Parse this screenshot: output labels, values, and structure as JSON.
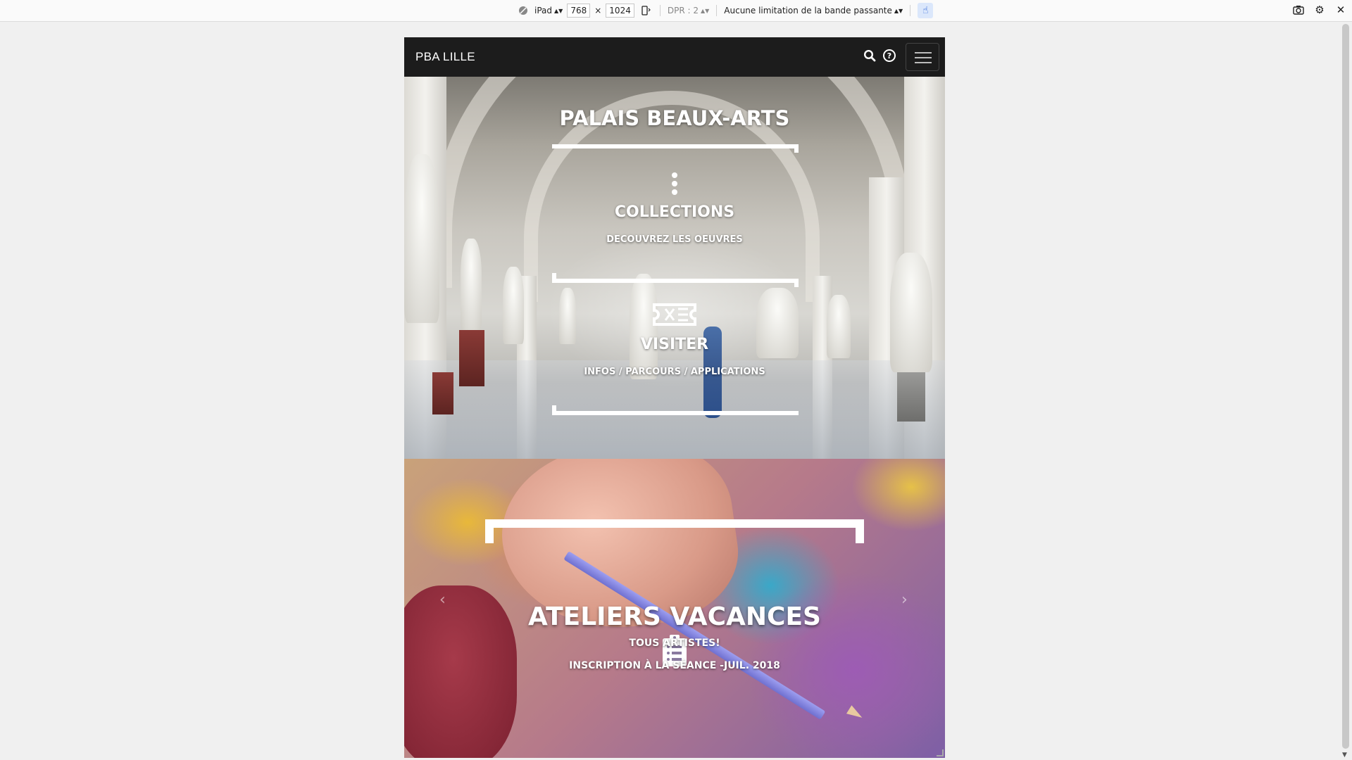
{
  "devtools": {
    "device": "iPad",
    "width": "768",
    "times": "×",
    "height": "1024",
    "dpr": "DPR : 2",
    "throttling": "Aucune limitation de la bande passante"
  },
  "site": {
    "brand": "PBA LILLE",
    "hero": {
      "title": "PALAIS BEAUX-ARTS",
      "items": [
        {
          "title": "COLLECTIONS",
          "subtitle": "DECOUVREZ LES OEUVRES"
        },
        {
          "title": "VISITER",
          "subtitle": "INFOS / PARCOURS / APPLICATIONS"
        }
      ]
    },
    "carousel": {
      "title": "ATELIERS VACANCES",
      "subtitle": "TOUS ARTISTES!",
      "detail": "INSCRIPTION À LA SÉANCE -JUIL. 2018",
      "prev": "‹",
      "next": "›"
    }
  },
  "icons": {
    "nav_search": "search-icon",
    "nav_help": "help-icon",
    "menu": "hamburger-icon",
    "collections": "more-vertical-icon",
    "visiter": "ticket-icon",
    "ateliers": "clipboard-list-icon"
  }
}
